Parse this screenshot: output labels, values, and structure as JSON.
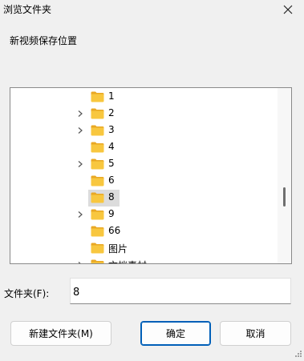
{
  "window": {
    "title": "浏览文件夹",
    "close_icon": "close-icon"
  },
  "description": "新视频保存位置",
  "tree": {
    "items": [
      {
        "label": "1",
        "expandable": false,
        "selected": false
      },
      {
        "label": "2",
        "expandable": true,
        "selected": false
      },
      {
        "label": "3",
        "expandable": true,
        "selected": false
      },
      {
        "label": "4",
        "expandable": false,
        "selected": false
      },
      {
        "label": "5",
        "expandable": true,
        "selected": false
      },
      {
        "label": "6",
        "expandable": false,
        "selected": false
      },
      {
        "label": "8",
        "expandable": false,
        "selected": true
      },
      {
        "label": "9",
        "expandable": true,
        "selected": false
      },
      {
        "label": "66",
        "expandable": false,
        "selected": false
      },
      {
        "label": "图片",
        "expandable": false,
        "selected": false
      },
      {
        "label": "文档素材",
        "expandable": true,
        "selected": false
      }
    ]
  },
  "folder_field": {
    "label": "文件夹(F):",
    "value": "8"
  },
  "buttons": {
    "new_folder": "新建文件夹(M)",
    "ok": "确定",
    "cancel": "取消"
  },
  "colors": {
    "folder_fill": "#f8c73f",
    "folder_tab": "#e9a824",
    "selection": "#dcdcdc",
    "accent": "#005fb8"
  }
}
